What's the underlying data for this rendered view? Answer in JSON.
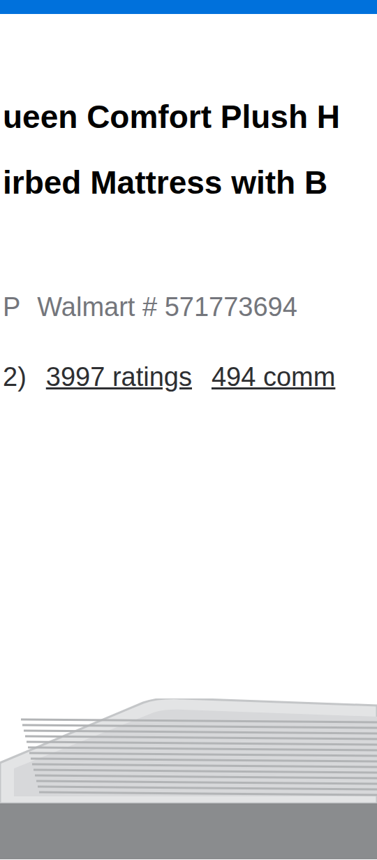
{
  "header": {
    "color": "#0071dc"
  },
  "title": {
    "lines": [
      "ueen Comfort Plush H",
      "irbed Mattress with B"
    ]
  },
  "meta": {
    "prefix": "P",
    "item_number": "Walmart # 571773694"
  },
  "ratings": {
    "prefix": "2)",
    "ratings_link": "3997 ratings",
    "comments_link": "494 comm"
  },
  "product_image": {
    "alt": "air mattress"
  }
}
